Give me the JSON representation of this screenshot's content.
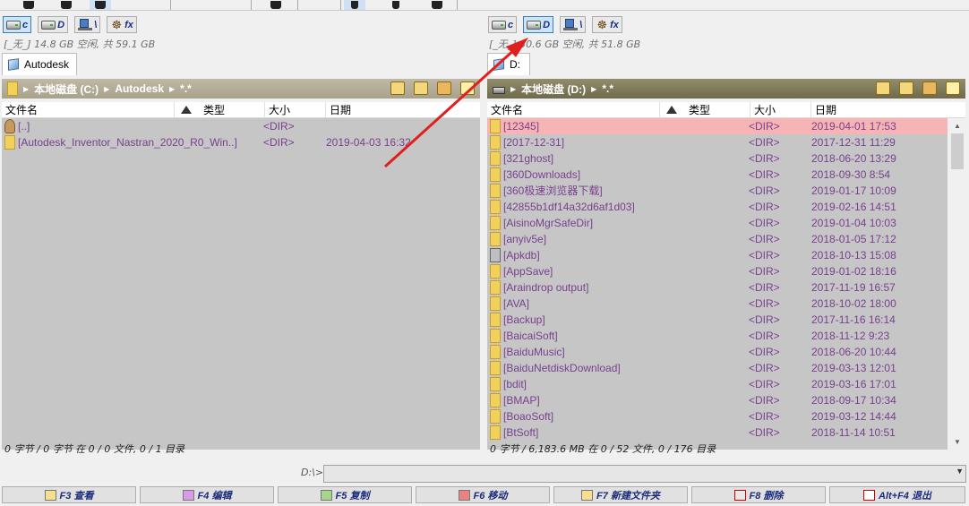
{
  "left_panel": {
    "drives": [
      {
        "label": "c",
        "icon": "hard-drive-icon",
        "active": true
      },
      {
        "label": "D",
        "icon": "hard-drive-icon",
        "active": false
      },
      {
        "label": "\\",
        "icon": "network-drive-icon",
        "active": false
      },
      {
        "label": "fx",
        "icon": "ship-wheel-icon",
        "active": false
      }
    ],
    "free_space": "[_无_] 14.8 GB 空闲, 共 59.1 GB",
    "tab": "Autodesk",
    "path": {
      "root": "本地磁盘 (C:)",
      "folder": "Autodesk",
      "filter": "*.*"
    },
    "columns": {
      "name": "文件名",
      "type": "类型",
      "size": "大小",
      "date": "日期"
    },
    "rows": [
      {
        "name": "[..]",
        "size": "<DIR>",
        "date": "",
        "icon": "up-icon"
      },
      {
        "name": "[Autodesk_Inventor_Nastran_2020_R0_Win..]",
        "size": "<DIR>",
        "date": "2019-04-03 16:32",
        "icon": "folder-icon"
      }
    ],
    "status": "0 字节 / 0 字节 在 0 / 0 文件, 0 / 1 目录"
  },
  "right_panel": {
    "drives": [
      {
        "label": "c",
        "icon": "hard-drive-icon",
        "active": false
      },
      {
        "label": "D",
        "icon": "hard-drive-icon",
        "active": true
      },
      {
        "label": "\\",
        "icon": "network-drive-icon",
        "active": false
      },
      {
        "label": "fx",
        "icon": "ship-wheel-icon",
        "active": false
      }
    ],
    "free_space": "[_无_] 30.6 GB 空闲, 共 51.8 GB",
    "tab": "D:",
    "path": {
      "root": "本地磁盘 (D:)",
      "filter": "*.*"
    },
    "columns": {
      "name": "文件名",
      "type": "类型",
      "size": "大小",
      "date": "日期"
    },
    "rows": [
      {
        "name": "[12345]",
        "size": "<DIR>",
        "date": "2019-04-01 17:53",
        "icon": "folder-icon",
        "selected": true
      },
      {
        "name": "[2017-12-31]",
        "size": "<DIR>",
        "date": "2017-12-31 11:29",
        "icon": "folder-icon"
      },
      {
        "name": "[321ghost]",
        "size": "<DIR>",
        "date": "2018-06-20 13:29",
        "icon": "folder-icon"
      },
      {
        "name": "[360Downloads]",
        "size": "<DIR>",
        "date": "2018-09-30 8:54",
        "icon": "folder-icon"
      },
      {
        "name": "[360极速浏览器下载]",
        "size": "<DIR>",
        "date": "2019-01-17 10:09",
        "icon": "folder-icon"
      },
      {
        "name": "[42855b1df14a32d6af1d03]",
        "size": "<DIR>",
        "date": "2019-02-16 14:51",
        "icon": "folder-icon"
      },
      {
        "name": "[AisinoMgrSafeDir]",
        "size": "<DIR>",
        "date": "2019-01-04 10:03",
        "icon": "folder-icon"
      },
      {
        "name": "[anyiv5e]",
        "size": "<DIR>",
        "date": "2018-01-05 17:12",
        "icon": "folder-icon"
      },
      {
        "name": "[Apkdb]",
        "size": "<DIR>",
        "date": "2018-10-13 15:08",
        "icon": "tool-icon"
      },
      {
        "name": "[AppSave]",
        "size": "<DIR>",
        "date": "2019-01-02 18:16",
        "icon": "folder-icon"
      },
      {
        "name": "[Araindrop output]",
        "size": "<DIR>",
        "date": "2017-11-19 16:57",
        "icon": "folder-icon"
      },
      {
        "name": "[AVA]",
        "size": "<DIR>",
        "date": "2018-10-02 18:00",
        "icon": "folder-icon"
      },
      {
        "name": "[Backup]",
        "size": "<DIR>",
        "date": "2017-11-16 16:14",
        "icon": "folder-icon"
      },
      {
        "name": "[BaicaiSoft]",
        "size": "<DIR>",
        "date": "2018-11-12 9:23",
        "icon": "folder-icon"
      },
      {
        "name": "[BaiduMusic]",
        "size": "<DIR>",
        "date": "2018-06-20 10:44",
        "icon": "folder-icon"
      },
      {
        "name": "[BaiduNetdiskDownload]",
        "size": "<DIR>",
        "date": "2019-03-13 12:01",
        "icon": "folder-icon"
      },
      {
        "name": "[bdit]",
        "size": "<DIR>",
        "date": "2019-03-16 17:01",
        "icon": "folder-icon"
      },
      {
        "name": "[BMAP]",
        "size": "<DIR>",
        "date": "2018-09-17 10:34",
        "icon": "folder-icon"
      },
      {
        "name": "[BoaoSoft]",
        "size": "<DIR>",
        "date": "2019-03-12 14:44",
        "icon": "folder-icon"
      },
      {
        "name": "[BtSoft]",
        "size": "<DIR>",
        "date": "2018-11-14 10:51",
        "icon": "folder-icon"
      }
    ],
    "status": "0 字节 / 6,183.6 MB 在 0 / 52 文件, 0 / 176 目录"
  },
  "command_line": {
    "label": "D:\\>",
    "value": ""
  },
  "function_keys": [
    {
      "label": "F3 查看",
      "icon": "view-icon"
    },
    {
      "label": "F4 编辑",
      "icon": "edit-icon"
    },
    {
      "label": "F5 复制",
      "icon": "copy-icon"
    },
    {
      "label": "F6 移动",
      "icon": "move-icon"
    },
    {
      "label": "F7 新建文件夹",
      "icon": "new-folder-icon"
    },
    {
      "label": "F8 删除",
      "icon": "delete-icon"
    },
    {
      "label": "Alt+F4 退出",
      "icon": "exit-icon"
    }
  ],
  "annotation_color": "#e0201e"
}
